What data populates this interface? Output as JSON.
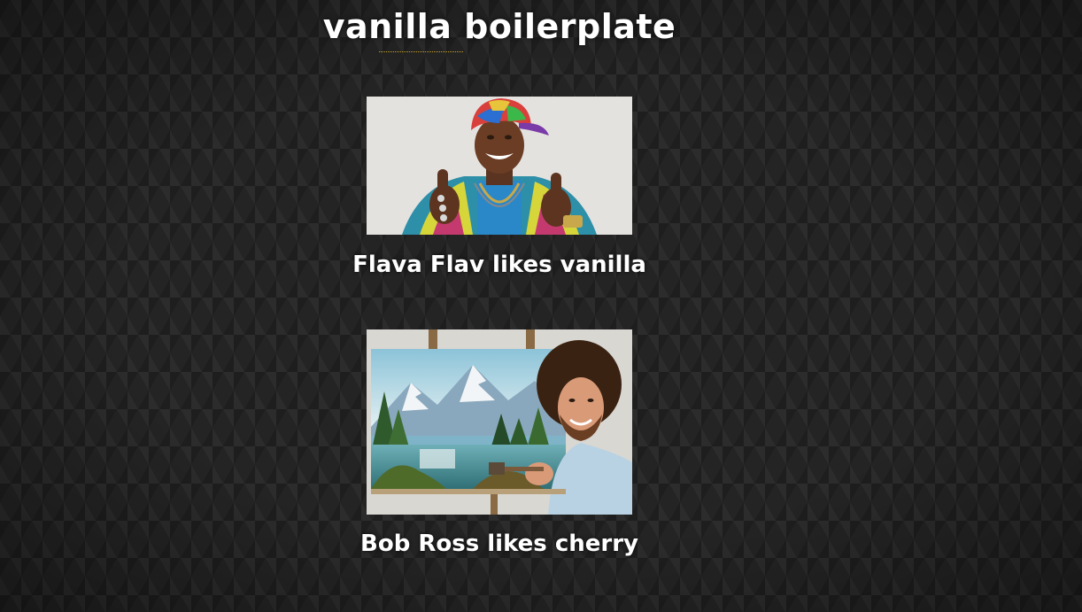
{
  "page": {
    "title": "vanilla boilerplate"
  },
  "cards": [
    {
      "caption": "Flava Flav likes vanilla",
      "image_alt": "Flava Flav photo"
    },
    {
      "caption": "Bob Ross likes cherry",
      "image_alt": "Bob Ross photo"
    }
  ],
  "colors": {
    "background": "#242424",
    "text": "#ffffff",
    "underline": "#c9a227"
  }
}
